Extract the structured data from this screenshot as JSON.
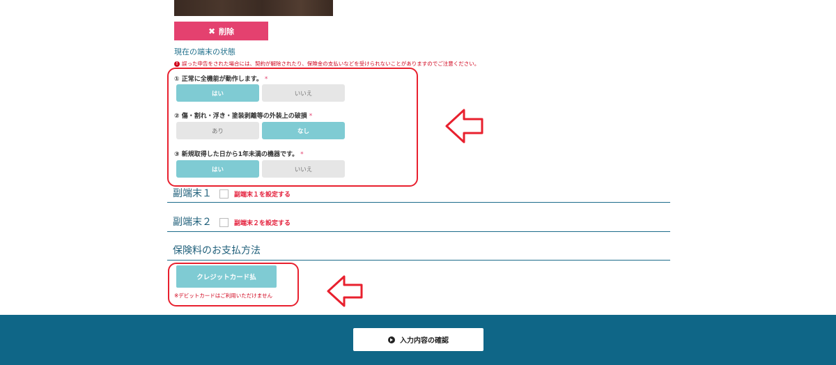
{
  "delete_button": {
    "icon": "close-icon",
    "label": "削除"
  },
  "device_status": {
    "title": "現在の端末の状態",
    "warning": "誤った申告をされた場合には、契約が解除されたり、保険金の支払いなどを受けられないことがありますのでご注意ください。",
    "questions": [
      {
        "label": "① 正常に全機能が動作します。",
        "required": "*",
        "options": [
          "はい",
          "いいえ"
        ],
        "selected": "はい"
      },
      {
        "label": "② 傷・割れ・浮き・塗装剥離等の外装上の破損",
        "required": "*",
        "options": [
          "あり",
          "なし"
        ],
        "selected": "なし"
      },
      {
        "label": "③ 新規取得した日から1年未満の機器です。",
        "required": "*",
        "options": [
          "はい",
          "いいえ"
        ],
        "selected": "はい"
      }
    ]
  },
  "sub_devices": [
    {
      "title": "副端末１",
      "checkbox_label": "副端末１を設定する",
      "checked": false
    },
    {
      "title": "副端末２",
      "checkbox_label": "副端末２を設定する",
      "checked": false
    }
  ],
  "payment": {
    "title": "保険料のお支払方法",
    "button": "クレジットカード払",
    "note": "※デビットカードはご利用いただけません"
  },
  "footer": {
    "confirm_icon": "circle-arrow-right-icon",
    "confirm_label": "入力内容の確認"
  },
  "colors": {
    "accent": "#7fcbd3",
    "delete": "#e4416f",
    "footer": "#0f6687",
    "annotation": "#e8202e",
    "warning": "#d0021b"
  }
}
